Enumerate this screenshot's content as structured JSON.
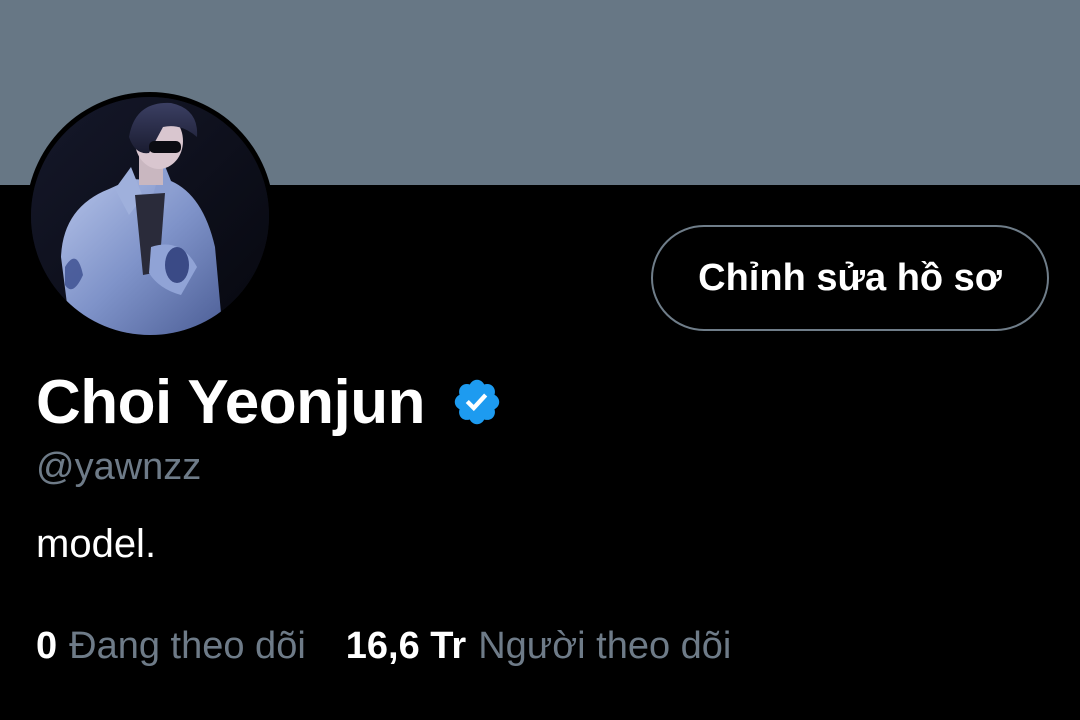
{
  "colors": {
    "background": "#000000",
    "banner": "#677785",
    "text_primary": "#ffffff",
    "text_secondary": "#6e7b88",
    "button_border": "#6f7d89",
    "verified_badge": "#1d9bf0"
  },
  "header": {
    "banner_color": "#677785"
  },
  "profile": {
    "avatar_icon": "profile-photo",
    "edit_button_label": "Chỉnh sửa hồ sơ",
    "display_name": "Choi Yeonjun",
    "verified_icon": "verified-badge-icon",
    "handle": "@yawnzz",
    "bio": "model."
  },
  "stats": {
    "following_count": "0",
    "following_label": "Đang theo dõi",
    "followers_count": "16,6 Tr",
    "followers_label": "Người theo dõi"
  }
}
